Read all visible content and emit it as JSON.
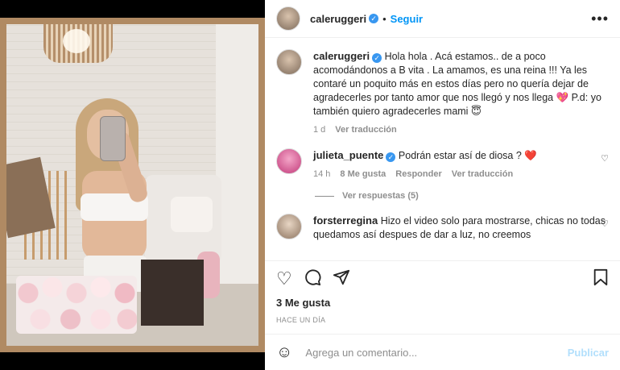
{
  "post": {
    "username": "caleruggeri",
    "follow_label": "Seguir",
    "more_label": "•••",
    "dot": "•"
  },
  "caption": {
    "username": "caleruggeri",
    "text": "Hola hola . Acá estamos.. de a poco acomodándonos a B vita . La amamos, es una reina !!! Ya les contaré un poquito más en estos días pero no quería dejar de agradecerles por tanto amor que nos llegó y nos llega 💖 P.d: yo también quiero agradecerles mami 😇",
    "time": "1 d",
    "translate": "Ver traducción"
  },
  "comments": [
    {
      "username": "julieta_puente",
      "text": "Podrán estar así de diosa ? ❤️",
      "time": "14 h",
      "likes": "8 Me gusta",
      "reply": "Responder",
      "translate": "Ver traducción",
      "view_replies": "Ver respuestas (5)"
    },
    {
      "username": "forsterregina",
      "text": "Hizo el video solo para mostrarse, chicas no todas quedamos así despues de dar a luz, no creemos"
    }
  ],
  "actions": {
    "like_icon": "heart-icon",
    "comment_icon": "comment-icon",
    "share_icon": "share-icon",
    "save_icon": "bookmark-icon"
  },
  "likes_count": "3 Me gusta",
  "posted_ago": "HACE UN DÍA",
  "add_comment": {
    "placeholder": "Agrega un comentario...",
    "publish_label": "Publicar"
  },
  "colors": {
    "accent": "#0095f6",
    "publish_disabled": "#b2dffc",
    "verified": "#3897f0",
    "like_red": "#ed4956"
  }
}
